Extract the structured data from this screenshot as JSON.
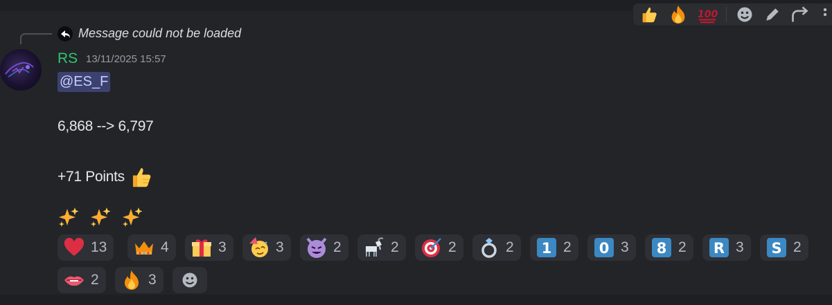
{
  "reply": {
    "text": "Message could not be loaded",
    "icon": "reply-arrow-icon"
  },
  "author": {
    "name": "RS",
    "color": "#2dc770",
    "timestamp": "13/11/2025 15:57"
  },
  "message": {
    "mention": "@ES_F",
    "line1": "6,868 --> 6,797",
    "line2": "+71 Points",
    "line2_emoji": "thumbs-up-icon",
    "sparkles": [
      "sparkles-icon",
      "sparkles-icon",
      "sparkles-icon"
    ]
  },
  "reactions": [
    {
      "emoji": "red-heart-icon",
      "count": "13"
    },
    {
      "emoji": "crown-icon",
      "count": "4"
    },
    {
      "emoji": "gift-icon",
      "count": "3"
    },
    {
      "emoji": "partying-face-icon",
      "count": "3"
    },
    {
      "emoji": "smiling-imp-icon",
      "count": "2"
    },
    {
      "emoji": "goat-icon",
      "count": "2"
    },
    {
      "emoji": "direct-hit-icon",
      "count": "2"
    },
    {
      "emoji": "ring-icon",
      "count": "2"
    },
    {
      "emoji": "keycap-1-icon",
      "count": "2"
    },
    {
      "emoji": "keycap-0-icon",
      "count": "3"
    },
    {
      "emoji": "keycap-8-icon",
      "count": "2"
    },
    {
      "emoji": "regional-r-icon",
      "count": "3"
    },
    {
      "emoji": "regional-s-icon",
      "count": "2"
    },
    {
      "emoji": "biting-lip-icon",
      "count": "2"
    },
    {
      "emoji": "fire-icon",
      "count": "3"
    }
  ],
  "keycaps": {
    "one": "1",
    "zero": "0",
    "eight": "8",
    "r": "R",
    "s": "S"
  },
  "toolbar": [
    "thumbs-up-icon",
    "fire-icon",
    "hundred-points-icon",
    "add-reaction-icon",
    "edit-icon",
    "reply-icon",
    "more-icon"
  ],
  "colors": {
    "background": "#232428",
    "reaction_bg": "#2e3035",
    "mention_bg": "#3c4270",
    "author": "#2dc770",
    "keycap_blue": "#3b88c3"
  }
}
